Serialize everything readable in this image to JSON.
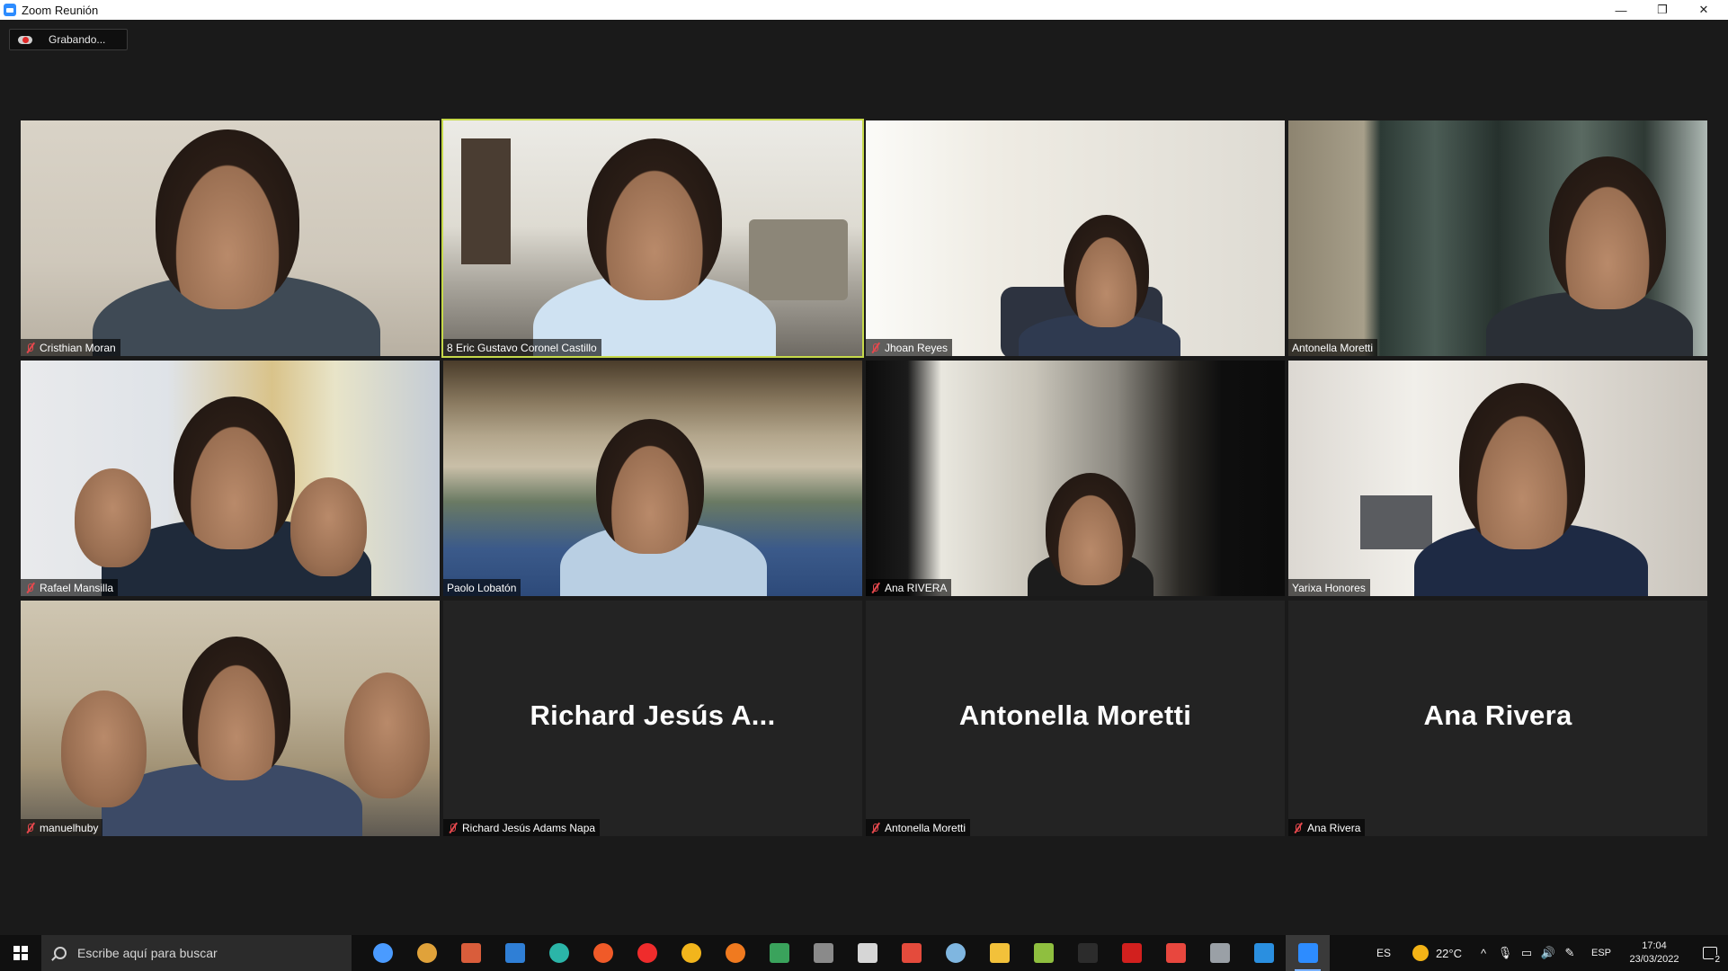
{
  "window": {
    "title": "Zoom Reunión",
    "minimize_glyph": "—",
    "restore_glyph": "❐",
    "close_glyph": "✕"
  },
  "recording": {
    "label": "Grabando...",
    "icon": "cloud-record-icon"
  },
  "participants": [
    {
      "name": "Cristhian Moran",
      "muted": true,
      "video": true
    },
    {
      "name": "8 Eric Gustavo Coronel Castillo",
      "muted": false,
      "video": true,
      "active_speaker": true
    },
    {
      "name": "Jhoan  Reyes",
      "muted": true,
      "video": true
    },
    {
      "name": "Antonella Moretti",
      "muted": false,
      "video": true
    },
    {
      "name": "Rafael Mansilla",
      "muted": true,
      "video": true
    },
    {
      "name": "Paolo Lobatón",
      "muted": false,
      "video": true
    },
    {
      "name": "Ana RIVERA",
      "muted": true,
      "video": true
    },
    {
      "name": "Yarixa Honores",
      "muted": false,
      "video": true
    },
    {
      "name": "manuelhuby",
      "muted": true,
      "video": true
    },
    {
      "name": "Richard Jesús Adams Napa",
      "display_name": "Richard  Jesús  A...",
      "muted": true,
      "video": false
    },
    {
      "name": "Antonella Moretti",
      "display_name": "Antonella Moretti",
      "muted": true,
      "video": false
    },
    {
      "name": "Ana Rivera",
      "display_name": "Ana Rivera",
      "muted": true,
      "video": false
    }
  ],
  "active_speaker_color": "#c6d94a",
  "taskbar": {
    "search_placeholder": "Escribe aquí para buscar",
    "apps": [
      {
        "icon": "cortana-icon",
        "color": "#4a9bff"
      },
      {
        "icon": "chrome-icon",
        "color": "#e0a23a"
      },
      {
        "icon": "chrome-profile-icon",
        "color": "#d95d3b"
      },
      {
        "icon": "mail-icon",
        "color": "#2f7fd6"
      },
      {
        "icon": "edge-icon",
        "color": "#2bb5a8"
      },
      {
        "icon": "brave-icon",
        "color": "#f05a28"
      },
      {
        "icon": "opera-icon",
        "color": "#ef2c2c"
      },
      {
        "icon": "tor-icon",
        "color": "#f2b51c"
      },
      {
        "icon": "firefox-icon",
        "color": "#f07a1f"
      },
      {
        "icon": "chrome-profile-2-icon",
        "color": "#3aa35c"
      },
      {
        "icon": "chrome-profile-3-icon",
        "color": "#8a8a8a"
      },
      {
        "icon": "chrome-profile-4-icon",
        "color": "#d6d6d6"
      },
      {
        "icon": "chrome-profile-5-icon",
        "color": "#e44b3c"
      },
      {
        "icon": "paint-icon",
        "color": "#7fb6e0"
      },
      {
        "icon": "file-explorer-icon",
        "color": "#f2c13a"
      },
      {
        "icon": "notepad-icon",
        "color": "#8fbf3f"
      },
      {
        "icon": "terminal-icon",
        "color": "#2c2c2c"
      },
      {
        "icon": "acrobat-icon",
        "color": "#d2201e"
      },
      {
        "icon": "anydesk-icon",
        "color": "#e8473e"
      },
      {
        "icon": "calculator-icon",
        "color": "#9aa0a6"
      },
      {
        "icon": "vscode-icon",
        "color": "#2a8fe0"
      },
      {
        "icon": "zoom-icon",
        "color": "#2d8cff",
        "active": true
      }
    ],
    "tray": {
      "input_lang": "ES",
      "temperature": "22°C",
      "keyboard_layout": "ESP",
      "time": "17:04",
      "date": "23/03/2022",
      "notifications": "2",
      "chevron_glyph": "^",
      "mic_glyph": "🎙",
      "battery_glyph": "▭",
      "volume_glyph": "🔊",
      "pen_glyph": "✎"
    }
  }
}
